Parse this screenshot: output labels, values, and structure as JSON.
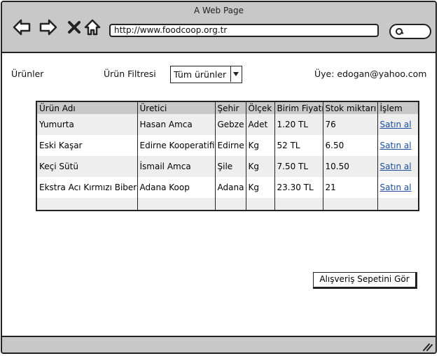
{
  "window": {
    "title": "A Web Page"
  },
  "browser": {
    "url": "http://www.foodcoop.org.tr"
  },
  "page": {
    "products_label": "Ürünler",
    "filter_label": "Ürün Filtresi",
    "filter_value": "Tüm ürünler",
    "member_label": "Üye: edogan@yahoo.com"
  },
  "table": {
    "headers": [
      "Ürün Adı",
      "Üretici",
      "Şehir",
      "Ölçek",
      "Birim Fiyatı",
      "Stok miktarı",
      "İşlem"
    ],
    "rows": [
      [
        "Yumurta",
        "Hasan Amca",
        "Gebze",
        "Adet",
        "1.20 TL",
        "76",
        "Satın al"
      ],
      [
        "Eski Kaşar",
        "Edirne Kooperatifi",
        "Edirne",
        "Kg",
        "52 TL",
        "6.50",
        "Satın al"
      ],
      [
        "Keçi Sütü",
        "İsmail Amca",
        "Şile",
        "Kg",
        "7.50 TL",
        "10.50",
        "Satın al"
      ],
      [
        "Ekstra Acı Kırmızı Biber",
        "Adana Koop",
        "Adana",
        "Kg",
        "23.30 TL",
        "21",
        "Satın al"
      ]
    ]
  },
  "cart_button": "Alışveriş Sepetini Gör",
  "icons": [
    "back-arrow-icon",
    "forward-arrow-icon",
    "close-icon",
    "home-icon",
    "search-icon",
    "resize-grip-icon"
  ]
}
